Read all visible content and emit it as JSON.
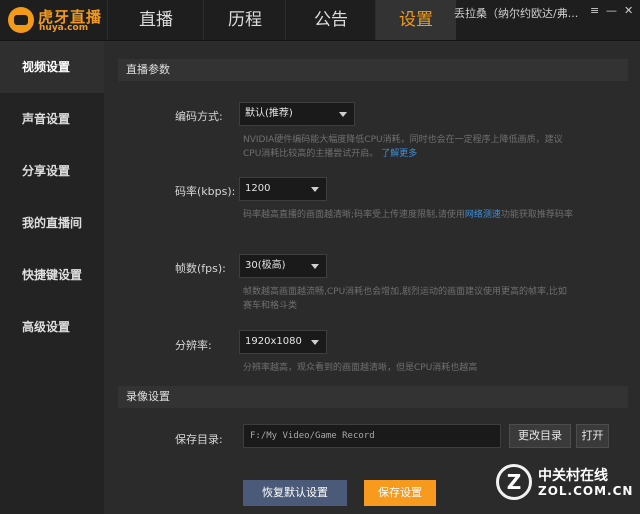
{
  "app": {
    "logo_text": "虎牙直播",
    "logo_sub": "huya.com"
  },
  "tabs": [
    {
      "label": "直播"
    },
    {
      "label": "历程"
    },
    {
      "label": "公告"
    },
    {
      "label": "设置"
    }
  ],
  "user": {
    "name": "丢拉桑（纳尔约欧达/弗..."
  },
  "window": {
    "menu_glyph": "≡",
    "minimize_glyph": "—",
    "close_glyph": "✕"
  },
  "sidebar": {
    "items": [
      {
        "label": "视频设置"
      },
      {
        "label": "声音设置"
      },
      {
        "label": "分享设置"
      },
      {
        "label": "我的直播间"
      },
      {
        "label": "快捷键设置"
      },
      {
        "label": "高级设置"
      }
    ]
  },
  "live": {
    "section_title": "直播参数",
    "encoding": {
      "label": "编码方式:",
      "value": "默认(推荐)",
      "hint": "NVIDIA硬件编码能大幅度降低CPU消耗，同时也会在一定程序上降低画质，建议CPU消耗比较高的主播尝试开启。",
      "link": "了解更多"
    },
    "bitrate": {
      "label": "码率(kbps):",
      "value": "1200",
      "hint_prefix": "码率越高直播的画面越清晰;码率受上传速度限制,请使用",
      "link": "网络测速",
      "hint_suffix": "功能获取推荐码率"
    },
    "fps": {
      "label": "帧数(fps):",
      "value": "30(极高)",
      "hint": "帧数越高画面越流畅,CPU消耗也会增加,剧烈运动的画面建议使用更高的帧率,比如赛车和格斗类"
    },
    "resolution": {
      "label": "分辨率:",
      "value": "1920x1080",
      "hint": "分辨率越高，观众看到的画面越清晰，但是CPU消耗也越高"
    }
  },
  "record": {
    "section_title": "录像设置",
    "dir_label": "保存目录:",
    "dir_value": "F:/My Video/Game Record",
    "change_button": "更改目录",
    "open_button": "打开"
  },
  "actions": {
    "reset_button": "恢复默认设置",
    "save_button": "保存设置"
  },
  "watermark": {
    "letter": "Z",
    "line1": "中关村在线",
    "line2": "ZOL.COM.CN"
  },
  "colors": {
    "accent": "#f39a18",
    "link": "#3f8fd8",
    "primary_button": "#f79a1e",
    "secondary_button": "#4a5a78"
  }
}
